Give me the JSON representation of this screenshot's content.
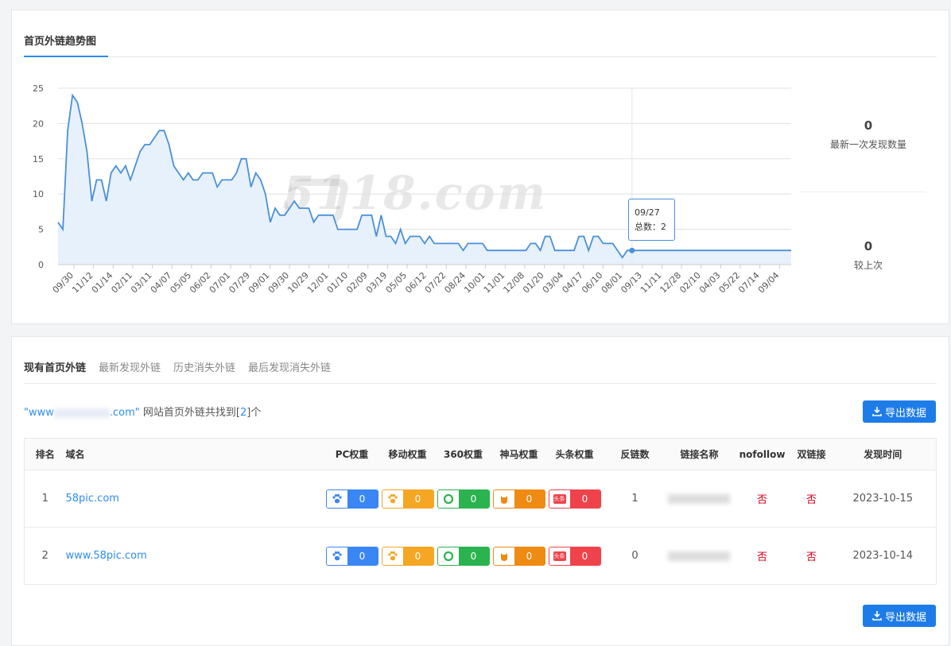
{
  "trend": {
    "title": "首页外链趋势图",
    "stats": [
      {
        "value": "0",
        "label": "最新一次发现数量"
      },
      {
        "value": "0",
        "label": "较上次"
      }
    ],
    "tooltip": {
      "date": "09/27",
      "label": "总数：2"
    },
    "watermark": "5118.com"
  },
  "chart_data": {
    "type": "area",
    "title": "",
    "ylim": [
      0,
      25
    ],
    "yticks": [
      0,
      5,
      10,
      15,
      20,
      25
    ],
    "xticks": [
      "09/30",
      "11/12",
      "01/14",
      "02/11",
      "03/11",
      "04/07",
      "05/05",
      "06/02",
      "07/01",
      "07/29",
      "09/01",
      "09/30",
      "10/29",
      "12/01",
      "01/10",
      "02/09",
      "03/19",
      "05/05",
      "06/12",
      "07/22",
      "08/24",
      "10/01",
      "11/01",
      "12/08",
      "01/20",
      "03/04",
      "04/17",
      "06/10",
      "08/01",
      "09/13",
      "11/11",
      "12/28",
      "02/10",
      "04/03",
      "05/22",
      "07/14",
      "09/04"
    ],
    "series": [
      {
        "values": [
          6,
          5,
          19,
          24,
          23,
          20,
          16,
          9,
          12,
          12,
          9,
          13,
          14,
          13,
          14,
          12,
          14,
          16,
          17,
          17,
          18,
          19,
          19,
          17,
          14,
          13,
          12,
          13,
          12,
          12,
          13,
          13,
          13,
          11,
          12,
          12,
          12,
          13,
          15,
          15,
          11,
          13,
          12,
          10,
          6,
          8,
          7,
          7,
          8,
          9,
          8,
          8,
          8,
          6,
          7,
          7,
          7,
          7,
          5,
          5,
          5,
          5,
          5,
          7,
          7,
          7,
          4,
          7,
          4,
          4,
          3,
          5,
          3,
          4,
          4,
          4,
          3,
          4,
          3,
          3,
          3,
          3,
          3,
          3,
          2,
          3,
          3,
          3,
          3,
          2,
          2,
          2,
          2,
          2,
          2,
          2,
          2,
          2,
          3,
          3,
          2,
          4,
          4,
          2,
          2,
          2,
          2,
          2,
          4,
          4,
          2,
          4,
          4,
          3,
          3,
          3,
          2,
          1,
          2,
          2,
          2,
          2,
          2,
          2,
          2,
          2,
          2,
          2,
          2,
          2,
          2,
          2,
          2,
          2,
          2,
          2,
          2,
          2,
          2,
          2,
          2,
          2,
          2,
          2,
          2,
          2,
          2,
          2,
          2,
          2,
          2,
          2,
          2
        ]
      }
    ],
    "highlight_index": 119,
    "colors": {
      "line": "#4a90d9",
      "area": "#e7f1fb",
      "grid": "#e0e0e0"
    }
  },
  "list": {
    "tabs": [
      "现有首页外链",
      "最新发现外链",
      "历史消失外链",
      "最后发现消失外链"
    ],
    "summary": {
      "quote_open": "\"www",
      "quote_close": ".com\"",
      "text_before": " 网站首页外链共找到[",
      "count": "2",
      "text_after": "]个"
    },
    "export_label": "导出数据",
    "headers": [
      "排名",
      "域名",
      "PC权重",
      "移动权重",
      "360权重",
      "神马权重",
      "头条权重",
      "反链数",
      "链接名称",
      "nofollow",
      "双链接",
      "发现时间"
    ],
    "rows": [
      {
        "rank": "1",
        "domain": "58pic.com",
        "pc": "0",
        "mobile": "0",
        "r360": "0",
        "shenma": "0",
        "toutiao": "0",
        "backlinks": "1",
        "nofollow": "否",
        "double": "否",
        "date": "2023-10-15"
      },
      {
        "rank": "2",
        "domain": "www.58pic.com",
        "pc": "0",
        "mobile": "0",
        "r360": "0",
        "shenma": "0",
        "toutiao": "0",
        "backlinks": "0",
        "nofollow": "否",
        "double": "否",
        "date": "2023-10-14"
      }
    ],
    "badge_colors": {
      "pc": "#3a86f5",
      "mobile": "#f5a623",
      "r360": "#2bb34f",
      "shenma": "#ef8a12",
      "toutiao": "#f0424b"
    },
    "toutiao_icon_text": "头条"
  }
}
